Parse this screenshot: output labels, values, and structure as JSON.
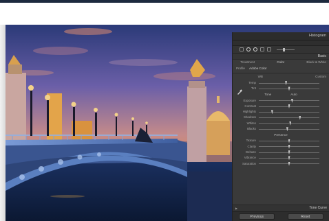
{
  "panel": {
    "header_title": "Histogram",
    "section_basic": "Basic",
    "treatment_label": "Treatment",
    "treatment_color": "Color",
    "treatment_bw": "Black & White",
    "profile_label": "Profile",
    "profile_value": "Adobe Color",
    "wb_label": "WB",
    "wb_value": "Custom",
    "tone_subhead": "Tone",
    "tone_auto": "Auto",
    "presence_subhead": "Presence",
    "tone_curve_label": "Tone Curve",
    "previous_button": "Previous",
    "reset_button": "Reset",
    "sliders_wb": [
      {
        "label": "Temp",
        "value": 0.45
      },
      {
        "label": "Tint",
        "value": 0.5
      }
    ],
    "sliders_tone": [
      {
        "label": "Exposure",
        "value": 0.55
      },
      {
        "label": "Contrast",
        "value": 0.5
      },
      {
        "label": "Highlights",
        "value": 0.22
      },
      {
        "label": "Shadows",
        "value": 0.68
      },
      {
        "label": "Whites",
        "value": 0.52
      },
      {
        "label": "Blacks",
        "value": 0.47
      }
    ],
    "sliders_presence": [
      {
        "label": "Texture",
        "value": 0.5
      },
      {
        "label": "Clarity",
        "value": 0.5
      },
      {
        "label": "Dehaze",
        "value": 0.5
      },
      {
        "label": "Vibrance",
        "value": 0.5
      },
      {
        "label": "Saturation",
        "value": 0.5
      }
    ]
  },
  "colors": {
    "sky_top": "#2b3a78",
    "sky_mid": "#6b5fa8",
    "sky_horizon": "#d98a5a",
    "water": "#12254a",
    "bridge": "#5a7fc0",
    "gold": "#e3a44a",
    "panel_bg": "#3a3a3a"
  }
}
